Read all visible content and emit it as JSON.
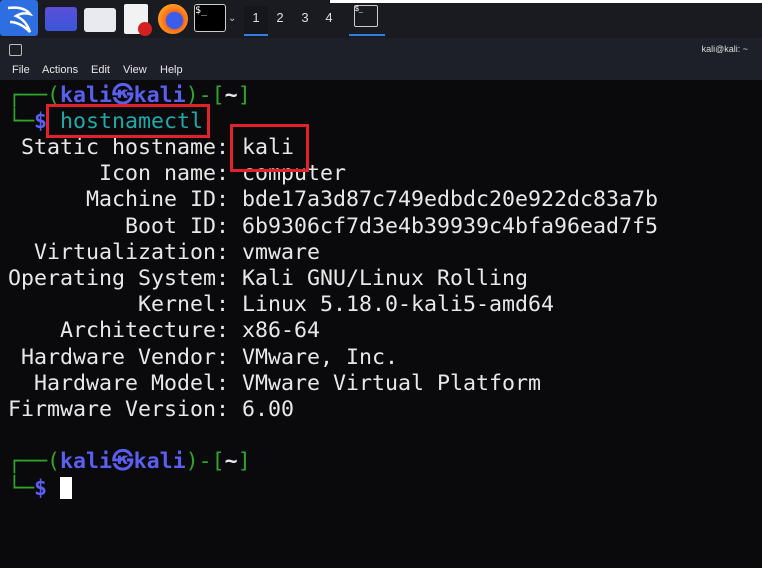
{
  "taskbar": {
    "workspaces": [
      "1",
      "2",
      "3",
      "4"
    ],
    "active_workspace": "1",
    "icons": [
      "kali-menu-icon",
      "show-desktop-icon",
      "file-manager-icon",
      "text-editor-icon",
      "firefox-icon",
      "terminal-icon"
    ]
  },
  "window": {
    "title": "kali@kali: ~"
  },
  "menu": [
    "File",
    "Actions",
    "Edit",
    "View",
    "Help"
  ],
  "terminal": {
    "prompt": {
      "open": "┌──(",
      "user": "kali",
      "at": "㉿",
      "host": "kali",
      "mid": ")-[",
      "dir": "~",
      "close": "]",
      "line2": "└─",
      "dollar": "$"
    },
    "command": "hostnamectl",
    "output": [
      {
        "label": " Static hostname:",
        "value": "kali"
      },
      {
        "label": "       Icon name:",
        "value": "computer"
      },
      {
        "label": "      Machine ID:",
        "value": "bde17a3d87c749edbdc20e922dc83a7b"
      },
      {
        "label": "         Boot ID:",
        "value": "6b9306cf7d3e4b39939c4bfa96ead7f5"
      },
      {
        "label": "  Virtualization:",
        "value": "vmware"
      },
      {
        "label": "Operating System:",
        "value": "Kali GNU/Linux Rolling"
      },
      {
        "label": "          Kernel:",
        "value": "Linux 5.18.0-kali5-amd64"
      },
      {
        "label": "    Architecture:",
        "value": "x86-64"
      },
      {
        "label": " Hardware Vendor:",
        "value": "VMware, Inc."
      },
      {
        "label": "  Hardware Model:",
        "value": "VMware Virtual Platform"
      },
      {
        "label": "Firmware Version:",
        "value": "6.00"
      }
    ]
  },
  "colors": {
    "highlight_box": "#e2222a",
    "prompt_user": "#5a5ff0",
    "prompt_frame": "#2fa52a",
    "command": "#1fa9a9"
  }
}
